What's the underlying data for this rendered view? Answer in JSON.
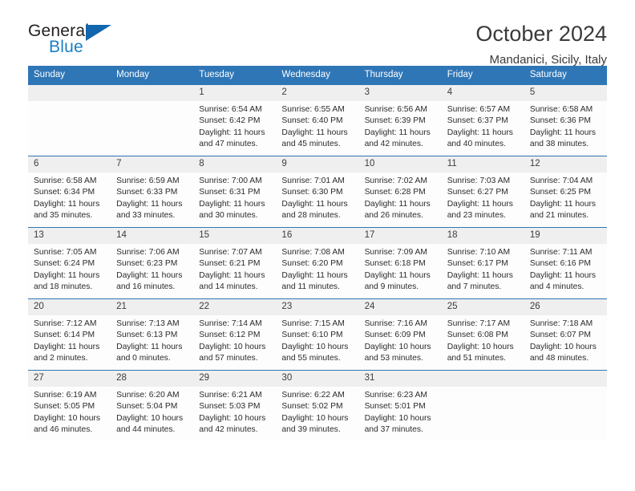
{
  "brand": {
    "name_part1": "General",
    "name_part2": "Blue",
    "logo_icon": "triangle-icon"
  },
  "header": {
    "title": "October 2024",
    "location": "Mandanici, Sicily, Italy"
  },
  "colors": {
    "header_blue": "#2f76b6",
    "brand_blue": "#1b7fc4",
    "daynum_band": "#efefef",
    "text": "#2b2b2b"
  },
  "calendar": {
    "weekday_headers": [
      "Sunday",
      "Monday",
      "Tuesday",
      "Wednesday",
      "Thursday",
      "Friday",
      "Saturday"
    ],
    "weeks": [
      [
        {
          "day": "",
          "sunrise": "",
          "sunset": "",
          "daylight1": "",
          "daylight2": ""
        },
        {
          "day": "",
          "sunrise": "",
          "sunset": "",
          "daylight1": "",
          "daylight2": ""
        },
        {
          "day": "1",
          "sunrise": "Sunrise: 6:54 AM",
          "sunset": "Sunset: 6:42 PM",
          "daylight1": "Daylight: 11 hours",
          "daylight2": "and 47 minutes."
        },
        {
          "day": "2",
          "sunrise": "Sunrise: 6:55 AM",
          "sunset": "Sunset: 6:40 PM",
          "daylight1": "Daylight: 11 hours",
          "daylight2": "and 45 minutes."
        },
        {
          "day": "3",
          "sunrise": "Sunrise: 6:56 AM",
          "sunset": "Sunset: 6:39 PM",
          "daylight1": "Daylight: 11 hours",
          "daylight2": "and 42 minutes."
        },
        {
          "day": "4",
          "sunrise": "Sunrise: 6:57 AM",
          "sunset": "Sunset: 6:37 PM",
          "daylight1": "Daylight: 11 hours",
          "daylight2": "and 40 minutes."
        },
        {
          "day": "5",
          "sunrise": "Sunrise: 6:58 AM",
          "sunset": "Sunset: 6:36 PM",
          "daylight1": "Daylight: 11 hours",
          "daylight2": "and 38 minutes."
        }
      ],
      [
        {
          "day": "6",
          "sunrise": "Sunrise: 6:58 AM",
          "sunset": "Sunset: 6:34 PM",
          "daylight1": "Daylight: 11 hours",
          "daylight2": "and 35 minutes."
        },
        {
          "day": "7",
          "sunrise": "Sunrise: 6:59 AM",
          "sunset": "Sunset: 6:33 PM",
          "daylight1": "Daylight: 11 hours",
          "daylight2": "and 33 minutes."
        },
        {
          "day": "8",
          "sunrise": "Sunrise: 7:00 AM",
          "sunset": "Sunset: 6:31 PM",
          "daylight1": "Daylight: 11 hours",
          "daylight2": "and 30 minutes."
        },
        {
          "day": "9",
          "sunrise": "Sunrise: 7:01 AM",
          "sunset": "Sunset: 6:30 PM",
          "daylight1": "Daylight: 11 hours",
          "daylight2": "and 28 minutes."
        },
        {
          "day": "10",
          "sunrise": "Sunrise: 7:02 AM",
          "sunset": "Sunset: 6:28 PM",
          "daylight1": "Daylight: 11 hours",
          "daylight2": "and 26 minutes."
        },
        {
          "day": "11",
          "sunrise": "Sunrise: 7:03 AM",
          "sunset": "Sunset: 6:27 PM",
          "daylight1": "Daylight: 11 hours",
          "daylight2": "and 23 minutes."
        },
        {
          "day": "12",
          "sunrise": "Sunrise: 7:04 AM",
          "sunset": "Sunset: 6:25 PM",
          "daylight1": "Daylight: 11 hours",
          "daylight2": "and 21 minutes."
        }
      ],
      [
        {
          "day": "13",
          "sunrise": "Sunrise: 7:05 AM",
          "sunset": "Sunset: 6:24 PM",
          "daylight1": "Daylight: 11 hours",
          "daylight2": "and 18 minutes."
        },
        {
          "day": "14",
          "sunrise": "Sunrise: 7:06 AM",
          "sunset": "Sunset: 6:23 PM",
          "daylight1": "Daylight: 11 hours",
          "daylight2": "and 16 minutes."
        },
        {
          "day": "15",
          "sunrise": "Sunrise: 7:07 AM",
          "sunset": "Sunset: 6:21 PM",
          "daylight1": "Daylight: 11 hours",
          "daylight2": "and 14 minutes."
        },
        {
          "day": "16",
          "sunrise": "Sunrise: 7:08 AM",
          "sunset": "Sunset: 6:20 PM",
          "daylight1": "Daylight: 11 hours",
          "daylight2": "and 11 minutes."
        },
        {
          "day": "17",
          "sunrise": "Sunrise: 7:09 AM",
          "sunset": "Sunset: 6:18 PM",
          "daylight1": "Daylight: 11 hours",
          "daylight2": "and 9 minutes."
        },
        {
          "day": "18",
          "sunrise": "Sunrise: 7:10 AM",
          "sunset": "Sunset: 6:17 PM",
          "daylight1": "Daylight: 11 hours",
          "daylight2": "and 7 minutes."
        },
        {
          "day": "19",
          "sunrise": "Sunrise: 7:11 AM",
          "sunset": "Sunset: 6:16 PM",
          "daylight1": "Daylight: 11 hours",
          "daylight2": "and 4 minutes."
        }
      ],
      [
        {
          "day": "20",
          "sunrise": "Sunrise: 7:12 AM",
          "sunset": "Sunset: 6:14 PM",
          "daylight1": "Daylight: 11 hours",
          "daylight2": "and 2 minutes."
        },
        {
          "day": "21",
          "sunrise": "Sunrise: 7:13 AM",
          "sunset": "Sunset: 6:13 PM",
          "daylight1": "Daylight: 11 hours",
          "daylight2": "and 0 minutes."
        },
        {
          "day": "22",
          "sunrise": "Sunrise: 7:14 AM",
          "sunset": "Sunset: 6:12 PM",
          "daylight1": "Daylight: 10 hours",
          "daylight2": "and 57 minutes."
        },
        {
          "day": "23",
          "sunrise": "Sunrise: 7:15 AM",
          "sunset": "Sunset: 6:10 PM",
          "daylight1": "Daylight: 10 hours",
          "daylight2": "and 55 minutes."
        },
        {
          "day": "24",
          "sunrise": "Sunrise: 7:16 AM",
          "sunset": "Sunset: 6:09 PM",
          "daylight1": "Daylight: 10 hours",
          "daylight2": "and 53 minutes."
        },
        {
          "day": "25",
          "sunrise": "Sunrise: 7:17 AM",
          "sunset": "Sunset: 6:08 PM",
          "daylight1": "Daylight: 10 hours",
          "daylight2": "and 51 minutes."
        },
        {
          "day": "26",
          "sunrise": "Sunrise: 7:18 AM",
          "sunset": "Sunset: 6:07 PM",
          "daylight1": "Daylight: 10 hours",
          "daylight2": "and 48 minutes."
        }
      ],
      [
        {
          "day": "27",
          "sunrise": "Sunrise: 6:19 AM",
          "sunset": "Sunset: 5:05 PM",
          "daylight1": "Daylight: 10 hours",
          "daylight2": "and 46 minutes."
        },
        {
          "day": "28",
          "sunrise": "Sunrise: 6:20 AM",
          "sunset": "Sunset: 5:04 PM",
          "daylight1": "Daylight: 10 hours",
          "daylight2": "and 44 minutes."
        },
        {
          "day": "29",
          "sunrise": "Sunrise: 6:21 AM",
          "sunset": "Sunset: 5:03 PM",
          "daylight1": "Daylight: 10 hours",
          "daylight2": "and 42 minutes."
        },
        {
          "day": "30",
          "sunrise": "Sunrise: 6:22 AM",
          "sunset": "Sunset: 5:02 PM",
          "daylight1": "Daylight: 10 hours",
          "daylight2": "and 39 minutes."
        },
        {
          "day": "31",
          "sunrise": "Sunrise: 6:23 AM",
          "sunset": "Sunset: 5:01 PM",
          "daylight1": "Daylight: 10 hours",
          "daylight2": "and 37 minutes."
        },
        {
          "day": "",
          "sunrise": "",
          "sunset": "",
          "daylight1": "",
          "daylight2": ""
        },
        {
          "day": "",
          "sunrise": "",
          "sunset": "",
          "daylight1": "",
          "daylight2": ""
        }
      ]
    ]
  }
}
